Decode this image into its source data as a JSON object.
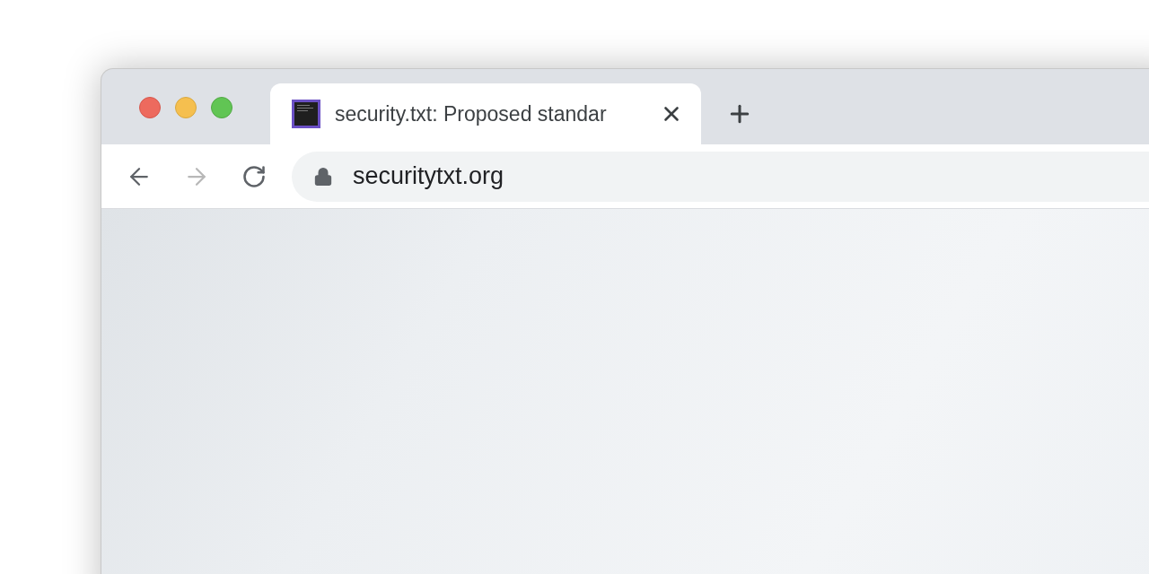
{
  "tabs": [
    {
      "title": "security.txt: Proposed standar",
      "selected": true
    }
  ],
  "toolbar": {
    "buttons": [
      {
        "kind": "back",
        "disabled": false
      },
      {
        "kind": "forward",
        "disabled": true
      },
      {
        "kind": "reload",
        "disabled": false
      }
    ],
    "address": {
      "secure": true,
      "url": "securitytxt.org"
    }
  }
}
